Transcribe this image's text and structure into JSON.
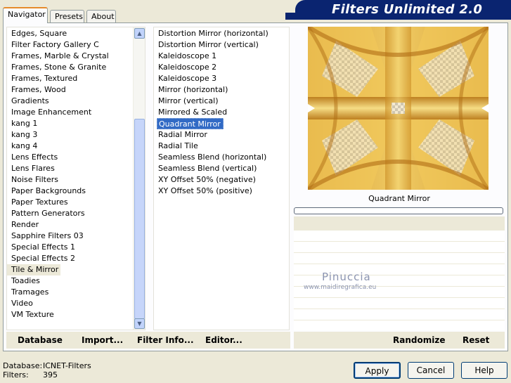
{
  "tabs": [
    {
      "label": "Navigator",
      "active": true
    },
    {
      "label": "Presets",
      "active": false
    },
    {
      "label": "About",
      "active": false
    }
  ],
  "banner_title": "Filters Unlimited 2.0",
  "categories": [
    "Edges, Square",
    "Filter Factory Gallery C",
    "Frames, Marble & Crystal",
    "Frames, Stone & Granite",
    "Frames, Textured",
    "Frames, Wood",
    "Gradients",
    "Image Enhancement",
    "kang 1",
    "kang 3",
    "kang 4",
    "Lens Effects",
    "Lens Flares",
    "Noise Filters",
    "Paper Backgrounds",
    "Paper Textures",
    "Pattern Generators",
    "Render",
    "Sapphire Filters 03",
    "Special Effects 1",
    "Special Effects 2",
    "Tile & Mirror",
    "Toadies",
    "Tramages",
    "Video",
    "VM Texture"
  ],
  "selected_category": "Tile & Mirror",
  "filters": [
    "Distortion Mirror (horizontal)",
    "Distortion Mirror (vertical)",
    "Kaleidoscope 1",
    "Kaleidoscope 2",
    "Kaleidoscope 3",
    "Mirror (horizontal)",
    "Mirror (vertical)",
    "Mirrored & Scaled",
    "Quadrant Mirror",
    "Radial Mirror",
    "Radial Tile",
    "Seamless Blend (horizontal)",
    "Seamless Blend (vertical)",
    "XY Offset 50% (negative)",
    "XY Offset 50% (positive)"
  ],
  "selected_filter": "Quadrant Mirror",
  "preview_caption": "Quadrant Mirror",
  "watermark": {
    "name": "Pinuccia",
    "url": "www.maidiregrafica.eu"
  },
  "toolbar": {
    "database": "Database",
    "import": "Import...",
    "filter_info": "Filter Info...",
    "editor": "Editor...",
    "randomize": "Randomize",
    "reset": "Reset"
  },
  "footer": {
    "database_label": "Database:",
    "database_value": "ICNET-Filters",
    "filters_label": "Filters:",
    "filters_value": "395"
  },
  "buttons": {
    "apply": "Apply",
    "cancel": "Cancel",
    "help": "Help"
  },
  "colors": {
    "banner": "#0a2470",
    "selection": "#316ac5",
    "dialog_bg": "#ece9d8"
  }
}
